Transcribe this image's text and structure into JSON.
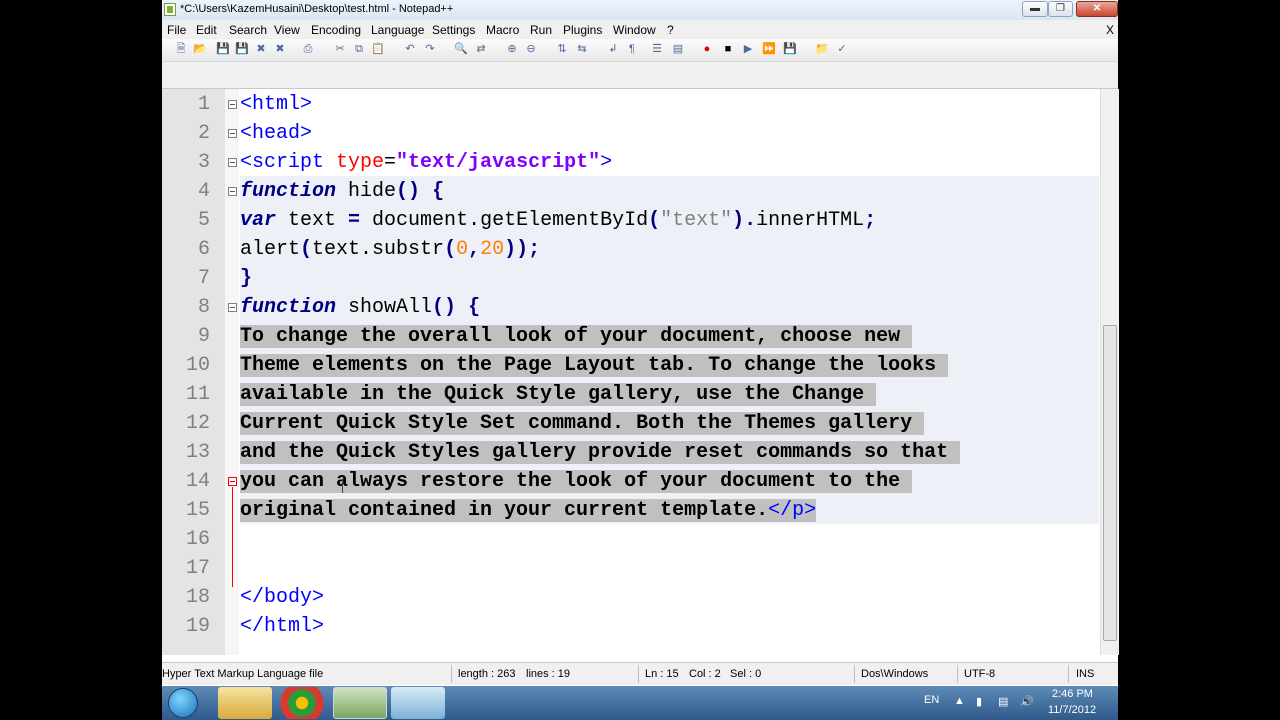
{
  "window": {
    "title": "*C:\\Users\\KazemHusaini\\Desktop\\test.html - Notepad++",
    "minimize_icon": "minimize-icon",
    "maximize_icon": "restore-icon",
    "close_icon": "close-icon"
  },
  "menu": {
    "items": [
      "File",
      "Edit",
      "Search",
      "View",
      "Encoding",
      "Language",
      "Settings",
      "Macro",
      "Run",
      "Plugins",
      "Window",
      "?"
    ],
    "close_label": "X"
  },
  "editor": {
    "line_numbers": [
      "1",
      "2",
      "3",
      "4",
      "5",
      "6",
      "7",
      "8",
      "9",
      "10",
      "11",
      "12",
      "13",
      "14",
      "15",
      "16",
      "17",
      "18",
      "19"
    ],
    "lines": [
      "<html>",
      "<head>",
      "<script type=\"text/javascript\">",
      "function hide() {",
      "var text = document.getElementById(\"text\").innerHTML;",
      "alert(text.substr(0,20));",
      "}",
      "function showAll() {",
      "To change the overall look of your document, choose new ",
      "Theme elements on the Page Layout tab. To change the looks ",
      "available in the Quick Style gallery, use the Change ",
      "Current Quick Style Set command. Both the Themes gallery ",
      "and the Quick Styles gallery provide reset commands so that ",
      "you can always restore the look of your document to the ",
      "original contained in your current template.</p>",
      "",
      "",
      "</body>",
      "</html>"
    ],
    "tokens": {
      "l3_tag_open": "<script ",
      "l3_attr": "type",
      "l3_eq": "=",
      "l3_str": "\"text/javascript\"",
      "l3_tag_close": ">",
      "l4_kw": "function",
      "l4_rest": " hide",
      "l4_paren": "()",
      "l4_space": " ",
      "l4_brace": "{",
      "l5_kw": "var",
      "l5_a": " text ",
      "l5_eq": "=",
      "l5_b": " document.getElementById",
      "l5_p1": "(",
      "l5_str": "\"text\"",
      "l5_p2": ").",
      "l5_c": "innerHTML",
      "l5_semi": ";",
      "l6_a": "alert",
      "l6_p1": "(",
      "l6_b": "text.substr",
      "l6_p2": "(",
      "l6_n1": "0",
      "l6_comma": ",",
      "l6_n2": "20",
      "l6_p3": "));",
      "l7_brace": "}",
      "l8_kw": "function",
      "l8_rest": " showAll",
      "l8_paren": "()",
      "l8_space": " ",
      "l8_brace": "{",
      "l15_text": "original contained in your current template.",
      "l15_tag": "</p>"
    }
  },
  "status": {
    "file_type": "Hyper Text Markup Language file",
    "length": "length : 263",
    "lines": "lines : 19",
    "ln": "Ln : 15",
    "col": "Col : 2",
    "sel": "Sel : 0",
    "eol": "Dos\\Windows",
    "encoding": "UTF-8",
    "mode": "INS"
  },
  "taskbar": {
    "lang": "EN",
    "time": "2:46 PM",
    "date": "11/7/2012"
  }
}
